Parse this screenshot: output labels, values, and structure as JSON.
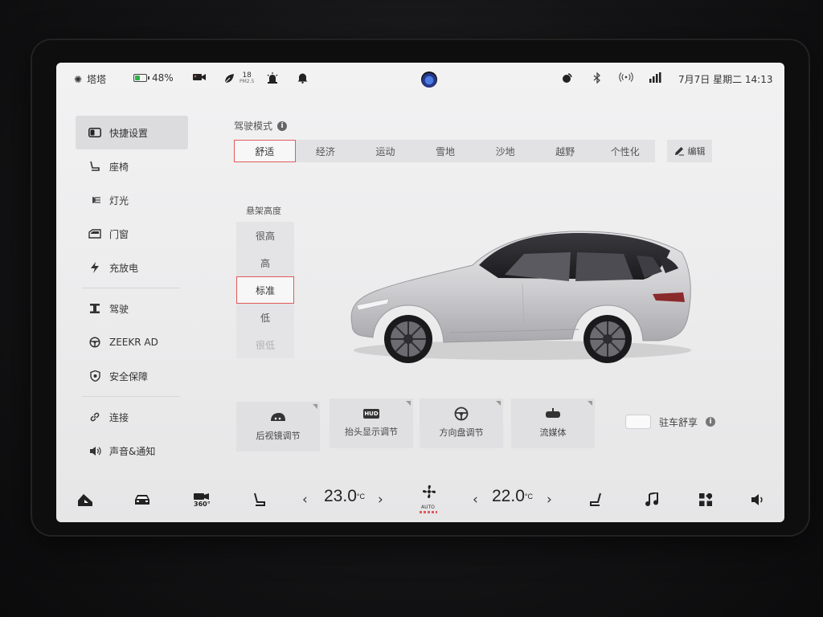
{
  "status": {
    "user_name": "塔塔",
    "battery": "48%",
    "pm_value": "18",
    "pm_unit": "PM2.5",
    "datetime": "7月7日 星期二 14:13"
  },
  "sidebar": {
    "items": [
      {
        "label": "快捷设置",
        "icon": "quick-settings-icon",
        "active": true
      },
      {
        "label": "座椅",
        "icon": "seat-icon"
      },
      {
        "label": "灯光",
        "icon": "light-icon"
      },
      {
        "label": "门窗",
        "icon": "door-window-icon"
      },
      {
        "label": "充放电",
        "icon": "charge-icon"
      },
      {
        "label": "驾驶",
        "icon": "drive-icon"
      },
      {
        "label": "ZEEKR AD",
        "icon": "steering-wheel-icon"
      },
      {
        "label": "安全保障",
        "icon": "shield-icon"
      },
      {
        "label": "连接",
        "icon": "link-icon"
      },
      {
        "label": "声音&通知",
        "icon": "speaker-icon"
      }
    ]
  },
  "drive_mode": {
    "title": "驾驶模式",
    "modes": [
      "舒适",
      "经济",
      "运动",
      "雪地",
      "沙地",
      "越野",
      "个性化"
    ],
    "selected": "舒适",
    "edit_label": "编辑"
  },
  "suspension": {
    "title": "悬架高度",
    "options": [
      "很高",
      "高",
      "标准",
      "低",
      "很低"
    ],
    "selected": "标准"
  },
  "quick_buttons": [
    {
      "label": "后视镜调节",
      "icon": "mirror-icon"
    },
    {
      "label": "抬头显示调节",
      "icon": "hud-icon",
      "icon_text": "HUD"
    },
    {
      "label": "方向盘调节",
      "icon": "steering-wheel-icon"
    },
    {
      "label": "流媒体",
      "icon": "rearview-mirror-icon"
    }
  ],
  "parking_comfort": {
    "label": "驻车舒享",
    "enabled": false
  },
  "climate": {
    "left_temp": "23.0",
    "right_temp": "22.0",
    "unit": "°C",
    "fan_mode": "AUTO"
  },
  "dock": {
    "view_360": "360°"
  },
  "colors": {
    "accent": "#e05a5a",
    "battery": "#2db34a",
    "screen_bg": "#efeff0"
  }
}
